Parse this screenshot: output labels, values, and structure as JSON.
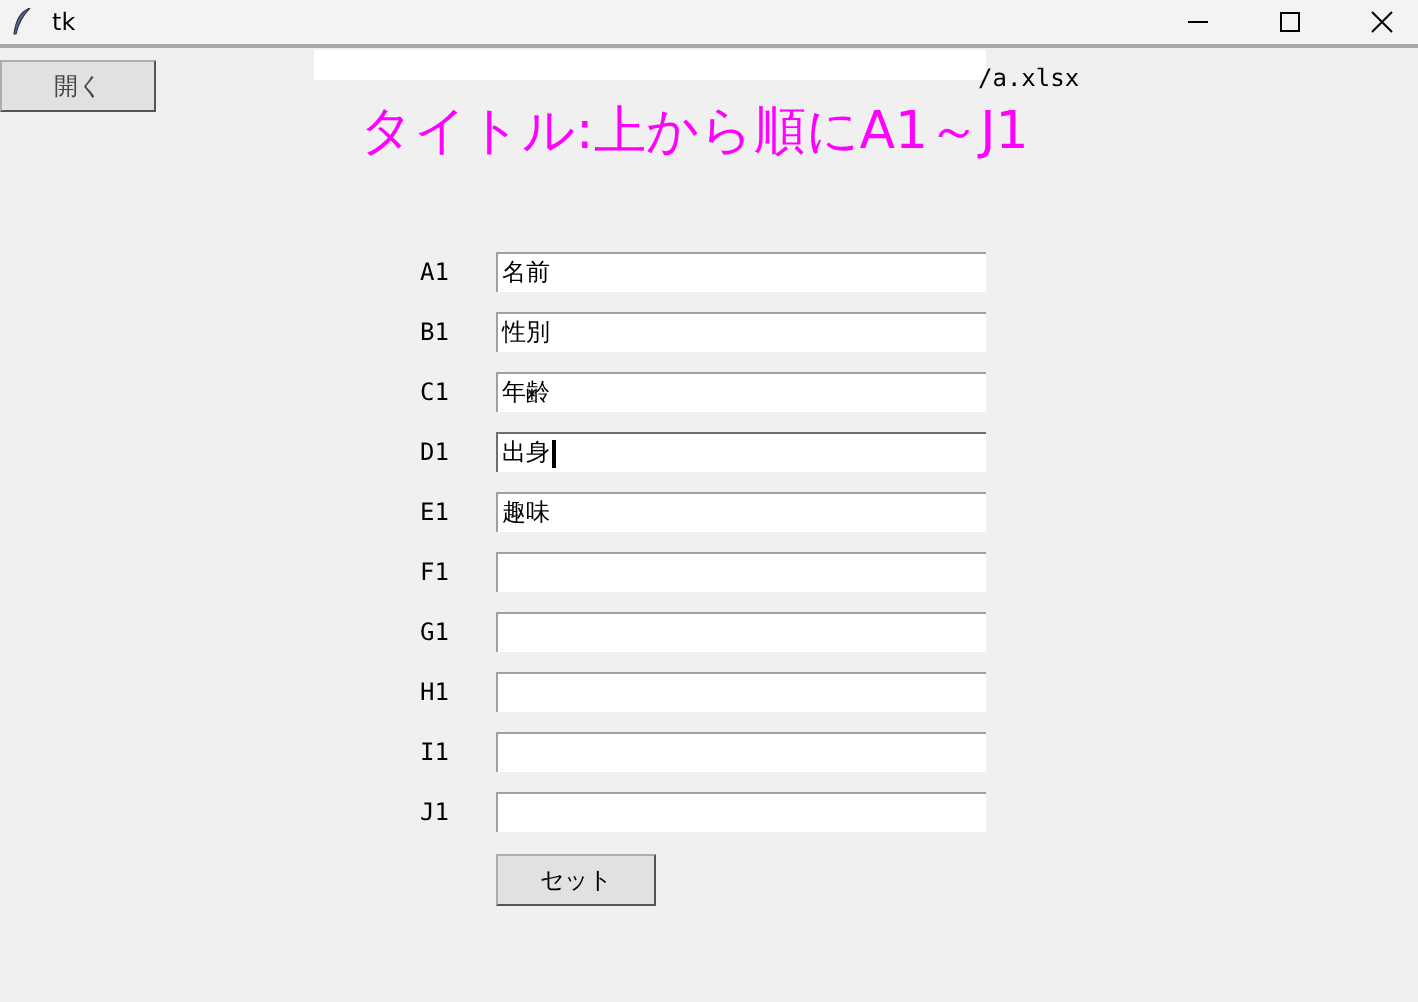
{
  "window": {
    "title": "tk"
  },
  "open_button": "開く",
  "file_path": "/a.xlsx",
  "heading": "タイトル:上から順にA1～J1",
  "fields": [
    {
      "label": "A1",
      "value": "名前",
      "focused": false
    },
    {
      "label": "B1",
      "value": "性別",
      "focused": false
    },
    {
      "label": "C1",
      "value": "年齢",
      "focused": false
    },
    {
      "label": "D1",
      "value": "出身",
      "focused": true
    },
    {
      "label": "E1",
      "value": "趣味",
      "focused": false
    },
    {
      "label": "F1",
      "focused": false
    },
    {
      "label": "G1",
      "focused": false
    },
    {
      "label": "H1",
      "focused": false
    },
    {
      "label": "I1",
      "focused": false
    },
    {
      "label": "J1",
      "focused": false
    }
  ],
  "set_button": "セット"
}
